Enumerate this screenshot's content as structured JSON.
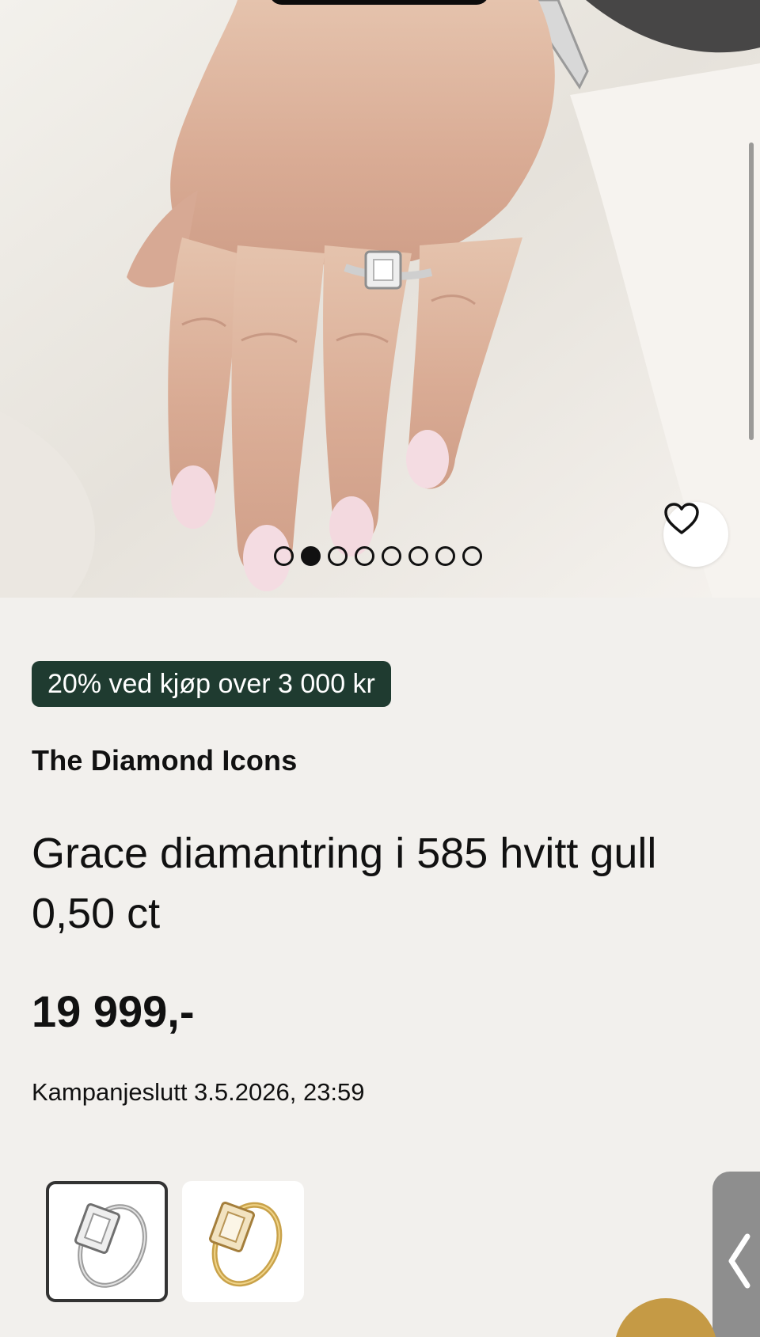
{
  "hero": {
    "image_alt": "Hand wearing diamond ring on white fabric",
    "carousel": {
      "total": 8,
      "active_index": 1
    }
  },
  "product": {
    "promo_badge": "20% ved kjøp over 3 000 kr",
    "brand": "The Diamond Icons",
    "title": "Grace diamantring i 585 hvitt gull 0,50 ct",
    "price": "19 999,-",
    "campaign_end": "Kampanjeslutt 3.5.2026, 23:59"
  },
  "variants": [
    {
      "metal": "white-gold",
      "selected": true
    },
    {
      "metal": "yellow-gold",
      "selected": false
    }
  ],
  "colors": {
    "promo_bg": "#1f3b30",
    "page_bg": "#f2f0ed",
    "accent_gold": "#c59a45"
  },
  "icons": {
    "favorite": "heart-outline-icon",
    "side_tab": "chevron-left-icon"
  }
}
